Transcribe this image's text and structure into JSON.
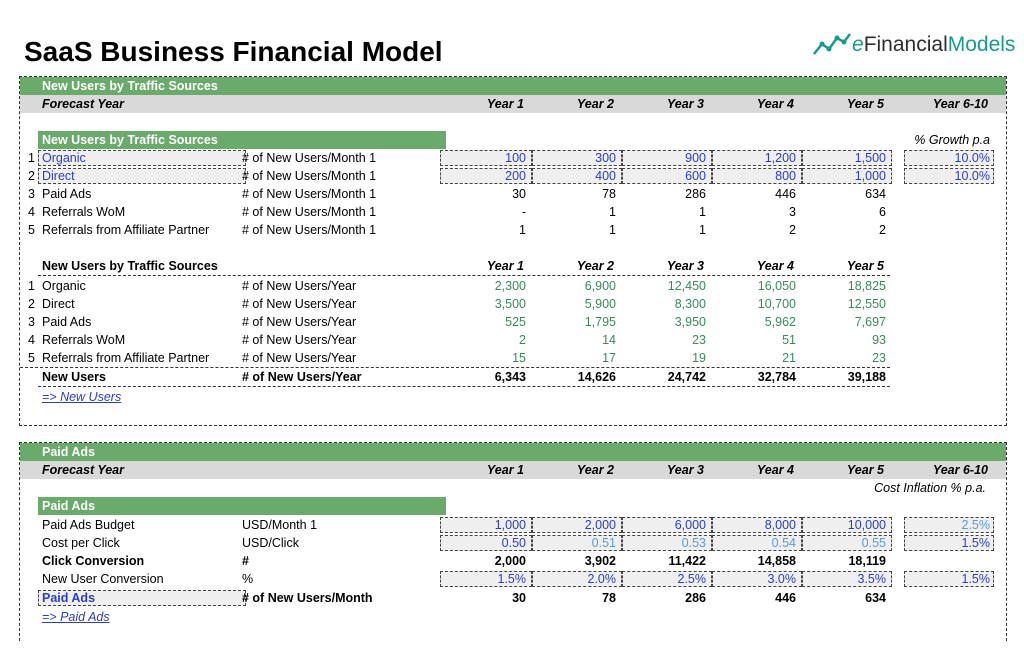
{
  "title": "SaaS Business Financial Model",
  "logo": {
    "e": "e",
    "financial": "Financial",
    "models": "Models",
    "icon": "chart-line-icon"
  },
  "years": [
    "Year 1",
    "Year 2",
    "Year 3",
    "Year 4",
    "Year 5",
    "Year 6-10"
  ],
  "years5": [
    "Year 1",
    "Year 2",
    "Year 3",
    "Year 4",
    "Year 5"
  ],
  "s1": {
    "header": "New Users by Traffic Sources",
    "forecast": "Forecast Year",
    "sub": "New Users by Traffic Sources",
    "growth": "% Growth p.a",
    "rows": [
      {
        "n": "1",
        "name": "Organic",
        "unit": "# of New Users/Month 1",
        "v": [
          "100",
          "300",
          "900",
          "1,200",
          "1,500"
        ],
        "g": "10.0%"
      },
      {
        "n": "2",
        "name": "Direct",
        "unit": "# of New Users/Month 1",
        "v": [
          "200",
          "400",
          "600",
          "800",
          "1,000"
        ],
        "g": "10.0%"
      },
      {
        "n": "3",
        "name": "Paid Ads",
        "unit": "# of New Users/Month 1",
        "v": [
          "30",
          "78",
          "286",
          "446",
          "634"
        ]
      },
      {
        "n": "4",
        "name": "Referrals WoM",
        "unit": "# of New Users/Month 1",
        "v": [
          "-",
          "1",
          "1",
          "3",
          "6"
        ]
      },
      {
        "n": "5",
        "name": "Referrals from Affiliate Partner",
        "unit": "# of New Users/Month 1",
        "v": [
          "1",
          "1",
          "1",
          "2",
          "2"
        ]
      }
    ],
    "yearTitle": "New Users by Traffic Sources",
    "yearRows": [
      {
        "n": "1",
        "name": "Organic",
        "unit": "# of New Users/Year",
        "v": [
          "2,300",
          "6,900",
          "12,450",
          "16,050",
          "18,825"
        ]
      },
      {
        "n": "2",
        "name": "Direct",
        "unit": "# of New Users/Year",
        "v": [
          "3,500",
          "5,900",
          "8,300",
          "10,700",
          "12,550"
        ]
      },
      {
        "n": "3",
        "name": "Paid Ads",
        "unit": "# of New Users/Year",
        "v": [
          "525",
          "1,795",
          "3,950",
          "5,962",
          "7,697"
        ]
      },
      {
        "n": "4",
        "name": "Referrals WoM",
        "unit": "# of New Users/Year",
        "v": [
          "2",
          "14",
          "23",
          "51",
          "93"
        ]
      },
      {
        "n": "5",
        "name": "Referrals from Affiliate Partner",
        "unit": "# of New Users/Year",
        "v": [
          "15",
          "17",
          "19",
          "21",
          "23"
        ]
      }
    ],
    "total": {
      "name": "New Users",
      "unit": "# of New Users/Year",
      "v": [
        "6,343",
        "14,626",
        "24,742",
        "32,784",
        "39,188"
      ]
    },
    "link": "=> New Users"
  },
  "s2": {
    "header": "Paid Ads",
    "forecast": "Forecast Year",
    "infl": "Cost Inflation % p.a.",
    "sub": "Paid Ads",
    "budget": {
      "name": "Paid Ads Budget",
      "unit": "USD/Month 1",
      "v": [
        "1,000",
        "2,000",
        "6,000",
        "8,000",
        "10,000"
      ],
      "g": "2.5%"
    },
    "cpc": {
      "name": "Cost per Click",
      "unit": "USD/Click",
      "v": [
        "0.50",
        "0.51",
        "0.53",
        "0.54",
        "0.55"
      ],
      "g": "1.5%"
    },
    "clicks": {
      "name": "Click Conversion",
      "unit": "#",
      "v": [
        "2,000",
        "3,902",
        "11,422",
        "14,858",
        "18,119"
      ]
    },
    "conv": {
      "name": "New User Conversion",
      "unit": "%",
      "v": [
        "1.5%",
        "2.0%",
        "2.5%",
        "3.0%",
        "3.5%"
      ],
      "g": "1.5%"
    },
    "paid": {
      "name": "Paid Ads",
      "unit": "# of New Users/Month",
      "v": [
        "30",
        "78",
        "286",
        "446",
        "634"
      ]
    },
    "link": "=> Paid Ads"
  }
}
